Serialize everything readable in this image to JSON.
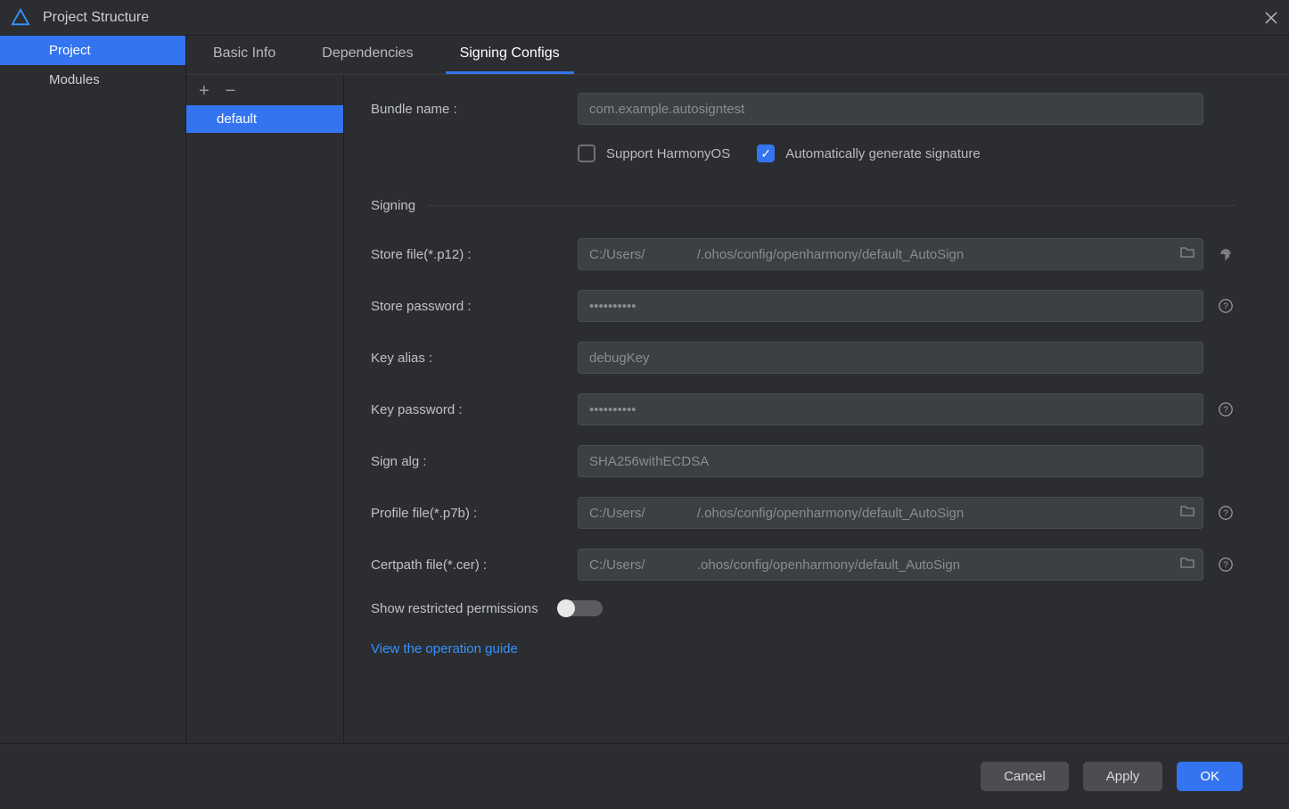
{
  "window": {
    "title": "Project Structure"
  },
  "sidebar": {
    "items": [
      {
        "label": "Project",
        "selected": true
      },
      {
        "label": "Modules",
        "selected": false
      }
    ]
  },
  "tabs": [
    {
      "label": "Basic Info",
      "active": false
    },
    {
      "label": "Dependencies",
      "active": false
    },
    {
      "label": "Signing Configs",
      "active": true
    }
  ],
  "configs": {
    "items": [
      {
        "label": "default",
        "selected": true
      }
    ]
  },
  "form": {
    "bundle_name_label": "Bundle name :",
    "bundle_name_value": "com.example.autosigntest",
    "support_harmony_label": "Support HarmonyOS",
    "support_harmony_checked": false,
    "auto_sign_label": "Automatically generate signature",
    "auto_sign_checked": true,
    "signing_header": "Signing",
    "store_file_label": "Store file(*.p12) :",
    "store_file_value": "C:/Users/              /.ohos/config/openharmony/default_AutoSign",
    "store_password_label": "Store password :",
    "store_password_value": "••••••••••",
    "key_alias_label": "Key alias :",
    "key_alias_value": "debugKey",
    "key_password_label": "Key password :",
    "key_password_value": "••••••••••",
    "sign_alg_label": "Sign alg :",
    "sign_alg_value": "SHA256withECDSA",
    "profile_file_label": "Profile file(*.p7b) :",
    "profile_file_value": "C:/Users/              /.ohos/config/openharmony/default_AutoSign",
    "certpath_file_label": "Certpath file(*.cer) :",
    "certpath_file_value": "C:/Users/              .ohos/config/openharmony/default_AutoSign",
    "show_restricted_label": "Show restricted permissions",
    "show_restricted_on": false,
    "guide_link": "View the operation guide"
  },
  "footer": {
    "cancel": "Cancel",
    "apply": "Apply",
    "ok": "OK"
  }
}
